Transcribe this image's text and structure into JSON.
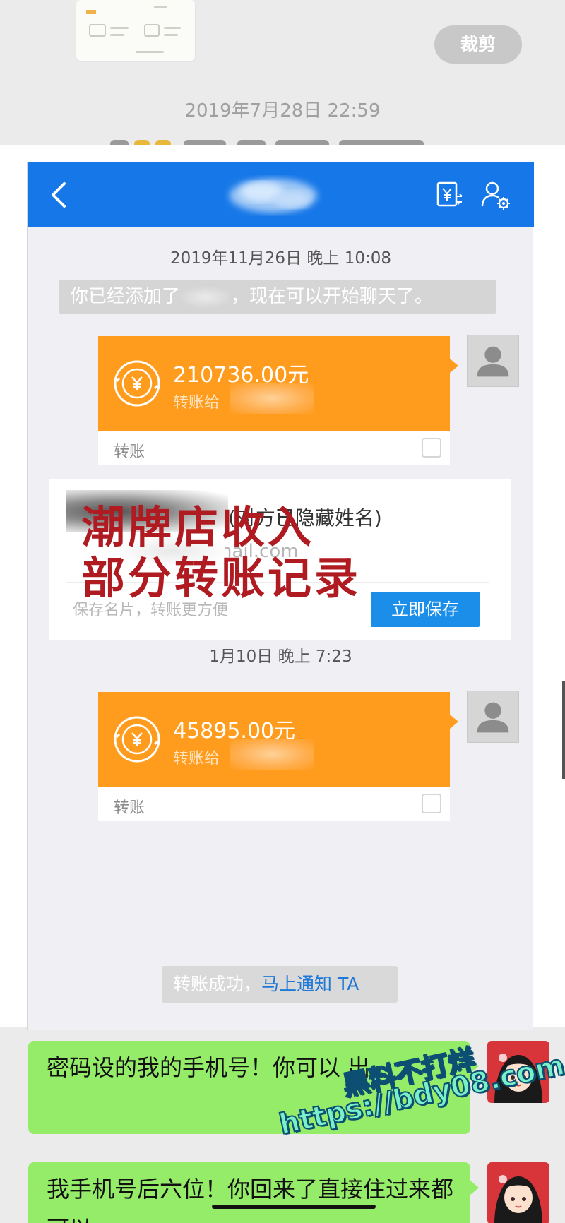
{
  "outer_chat": {
    "crop_button": "裁剪",
    "timestamp": "2019年7月28日 22:59"
  },
  "screenshot": {
    "nav": {
      "back_icon": "chevron-left-icon",
      "bill_icon": "yuan-bill-icon",
      "settings_icon": "user-settings-icon"
    },
    "time1": "2019年11月26日 晚上 10:08",
    "system_message": {
      "prefix": "你已经添加了",
      "suffix": "，现在可以开始聊天了。"
    },
    "transfer1": {
      "amount": "210736.00元",
      "to": "转账给",
      "label": "转账"
    },
    "contact_card": {
      "hidden_name": "(对方已隐藏姓名)",
      "email": "otmail.com",
      "save_hint": "保存名片，转账更方便",
      "save_button": "立即保存"
    },
    "overlay": {
      "line1": "潮牌店收入",
      "line2": "部分转账记录"
    },
    "time2": "1月10日 晚上 7:23",
    "transfer2": {
      "amount": "45895.00元",
      "to": "转账给",
      "label": "转账"
    },
    "success_message": {
      "text": "转账成功，",
      "link": "马上通知 TA"
    },
    "colors": {
      "nav": "#1677e8",
      "transfer": "#ff9c1e",
      "link": "#1e78d8",
      "overlay_text": "#b01b22"
    }
  },
  "messages": [
    {
      "text": "密码设的我的手机号！你可以 出"
    },
    {
      "text": "我手机号后六位！你回来了直接住过来都可以"
    }
  ],
  "watermark": {
    "line1": "黑料不打烊",
    "line2": "https://bdy08.com"
  }
}
